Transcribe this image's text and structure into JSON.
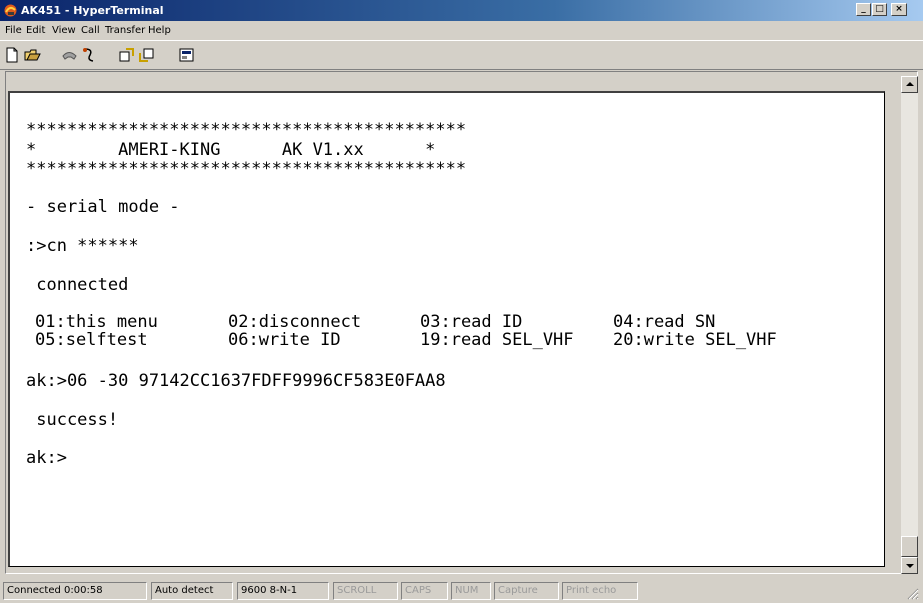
{
  "window": {
    "title": "AK451 - HyperTerminal",
    "min_label": "_",
    "max_label": "□",
    "close_label": "×"
  },
  "menu": [
    "File",
    "Edit",
    "View",
    "Call",
    "Transfer",
    "Help"
  ],
  "toolbar": [
    "new-icon",
    "open-icon",
    "phone-icon",
    "disconnect-icon",
    "send-icon",
    "receive-icon",
    "properties-icon"
  ],
  "terminal": {
    "lines": {
      "stars_top": "*******************************************",
      "banner": "*        AMERI-KING      AK V1.xx      *",
      "stars_bottom": "*******************************************",
      "mode": "- serial mode -",
      "cn": ":>cn ******",
      "connected": " connected",
      "cmd_write": "ak:>06 -30 97142CC1637FDFF9996CF583E0FAA8",
      "success": " success!",
      "prompt": "ak:>"
    },
    "menu_rows": [
      [
        "01:this menu",
        "02:disconnect",
        "03:read ID",
        "04:read SN"
      ],
      [
        "05:selftest",
        "06:write ID",
        "19:read SEL_VHF",
        "20:write SEL_VHF"
      ]
    ]
  },
  "status": {
    "connected": "Connected 0:00:58",
    "detect": "Auto detect",
    "port": "9600 8-N-1",
    "scroll": "SCROLL",
    "caps": "CAPS",
    "num": "NUM",
    "capture": "Capture",
    "print": "Print echo"
  }
}
